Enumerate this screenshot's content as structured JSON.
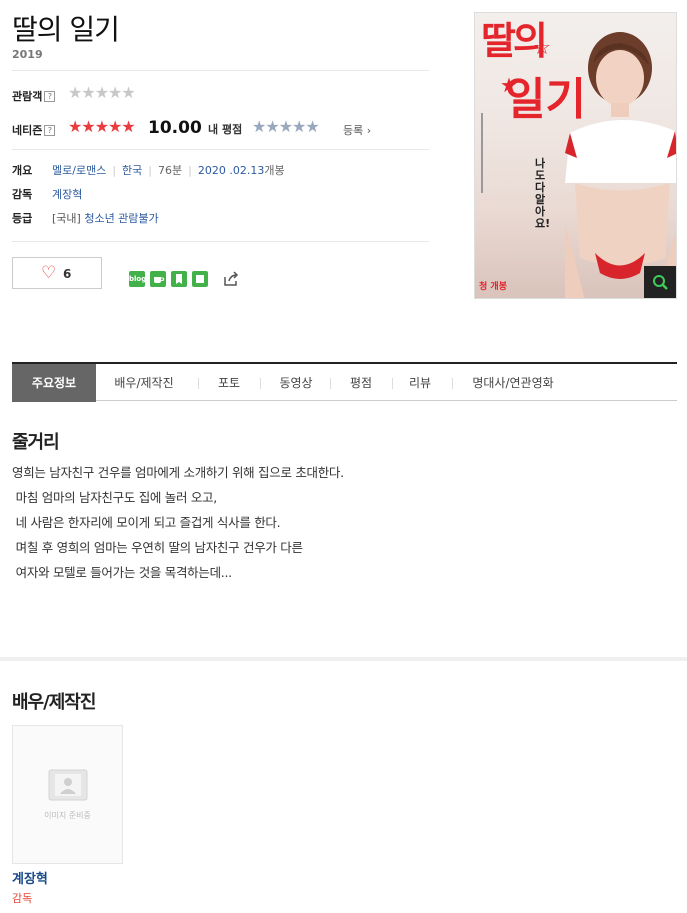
{
  "movie": {
    "title": "딸의 일기",
    "year": "2019"
  },
  "ratings": {
    "audience_label": "관람객",
    "netizen_label": "네티즌",
    "help_icon": "?",
    "audience_stars": "★★★★★",
    "netizen_stars": "★★★★★",
    "netizen_score": "10.00",
    "my_rating_label": "내 평점",
    "my_stars": "★★★★★",
    "register_label": "등록 ›",
    "audience_rating_fraction": 0,
    "netizen_rating_fraction": 1.0
  },
  "info": {
    "overview_label": "개요",
    "genre": "멜로/로맨스",
    "country": "한국",
    "runtime": "76분",
    "release_date": "2020 .02.13",
    "release_suffix": "개봉",
    "director_label": "감독",
    "director": "계장혁",
    "grade_label": "등급",
    "grade_region": "[국내]",
    "grade_value": "청소년 관람불가"
  },
  "like": {
    "count": "6"
  },
  "share_icons": [
    "blog-icon",
    "cafe-icon",
    "bookmark-icon",
    "share-green-icon",
    "share-link-icon"
  ],
  "share_blog_text": "blog",
  "poster": {
    "title_line1": "딸의",
    "title_line2": "일기",
    "tagline": "나도 다 알아요!",
    "badge": "청 개봉"
  },
  "tabs": [
    {
      "label": "주요정보",
      "active": true
    },
    {
      "label": "배우/제작진"
    },
    {
      "label": "포토"
    },
    {
      "label": "동영상"
    },
    {
      "label": "평점"
    },
    {
      "label": "리뷰"
    },
    {
      "label": "명대사/연관영화"
    }
  ],
  "synopsis": {
    "heading": "줄거리",
    "lines": [
      "영희는 남자친구 건우를 엄마에게 소개하기 위해 집으로 초대한다.",
      "",
      " 마침 엄마의 남자친구도 집에 놀러 오고,",
      " 네 사람은 한자리에 모이게 되고 즐겁게 식사를 한다.",
      "",
      " 며칠 후 영희의 엄마는 우연히 딸의 남자친구 건우가 다른",
      " 여자와 모텔로 들어가는 것을 목격하는데..."
    ]
  },
  "cast": {
    "heading": "배우/제작진",
    "people": [
      {
        "name": "계장혁",
        "role": "감독",
        "image_placeholder": "이미지 준비중"
      }
    ]
  },
  "colors": {
    "accent_red": "#ea3b3e",
    "link_blue": "#2c5aa0",
    "active_tab": "#666666",
    "share_green": "#43b14a"
  }
}
